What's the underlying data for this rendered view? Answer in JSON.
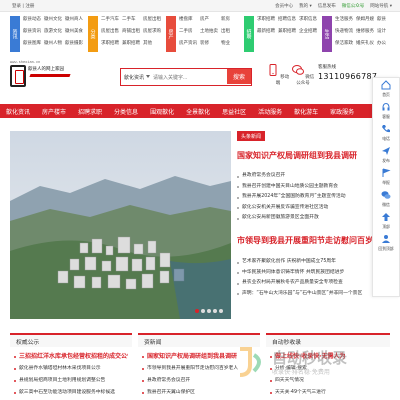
{
  "topbar": {
    "left": "登录 | 注册",
    "right": [
      "会员中心",
      "我的 ▾",
      "信息发布",
      "微信公众号",
      "网站导航 ▾"
    ]
  },
  "nav_groups": [
    {
      "tag": "资讯",
      "color": "#3a7bd5",
      "links": [
        "歙县动态",
        "徽州文化",
        "徽州商人",
        "歙县资讯",
        "旅游文化",
        "徽州美食",
        "歙县图库",
        "徽州人物",
        "歙县摄影"
      ]
    },
    {
      "tag": "分类",
      "color": "#f39c12",
      "links": [
        "二手汽车",
        "二手车",
        "房屋出租",
        "房屋出售",
        "商铺出租",
        "房屋求购",
        "求职招聘",
        "兼职招聘",
        "其他"
      ]
    },
    {
      "tag": "房产",
      "color": "#e74c3c",
      "links": [
        "楼盘库",
        "房产",
        "新房",
        "二手房",
        "土地拍卖",
        "出租",
        "房产资讯",
        "装修",
        "物业"
      ]
    },
    {
      "tag": "招聘",
      "color": "#2ecc71",
      "links": [
        "求职招聘",
        "招聘信息",
        "求职信息",
        "最新招聘",
        "兼职招聘",
        "企业招聘"
      ]
    },
    {
      "tag": "生活",
      "color": "#8e44ad",
      "links": [
        "生活服务",
        "保姆月嫂",
        "歙县",
        "快递物流",
        "维修服务",
        "设计",
        "保洁家政",
        "婚庆礼仪",
        "办公"
      ]
    }
  ],
  "logo": {
    "url": "www.shexian.cn",
    "slogan": "歙县人的网上家园"
  },
  "search": {
    "category": "歙化资讯",
    "placeholder": "请输入关键字...",
    "button": "搜索"
  },
  "icons": [
    {
      "label": "移动端"
    },
    {
      "label": "微信公众号"
    }
  ],
  "phone": {
    "label": "客服热线",
    "number": "13110966787"
  },
  "mainnav": [
    "歙化资讯",
    "房产楼市",
    "招聘求职",
    "分类信息",
    "围观歙化",
    "全景歙化",
    "思益社区",
    "活动服务",
    "歙化游车",
    "家政服务"
  ],
  "headline_badge": "头条新闻",
  "headline1": "国家知识产权局调研组到我县调研",
  "list1": [
    "县政府常务会议召开",
    "我县召开创建中国天目山地质公园主题教育会",
    "我县开展2024年“全国国防教育月”主题宣传活动",
    "歙化公安机关开展反诈骗宣传进社区活动",
    "歙化公安局新团徽旅游景区全面开放"
  ],
  "headline2": "市领导到我县开展重阳节走访慰问百岁老人",
  "list2": [
    "艺术家齐聚歙化创作 庆祝新中国成立75周年",
    "中华民族共同体意识铸牢情怀 共筑民族团结进步",
    "县农业农村局开展秋冬农产品质量安全专项检查",
    "声明：“石牛山大湾乐园”与“石牛山景区”并非同一个景区"
  ],
  "sidebar": [
    {
      "label": "首页",
      "icon": "home-icon"
    },
    {
      "label": "客服",
      "icon": "headset-icon"
    },
    {
      "label": "电话",
      "icon": "phone-icon"
    },
    {
      "label": "发布",
      "icon": "send-icon"
    },
    {
      "label": "举报",
      "icon": "flag-icon"
    },
    {
      "label": "微信",
      "icon": "wechat-icon"
    },
    {
      "label": "顶部",
      "icon": "top-icon"
    },
    {
      "label": "回到顶部",
      "icon": "user-icon"
    }
  ],
  "panels": [
    {
      "title": "权威公示",
      "items": [
        {
          "text": "三招招红洋水库承包经营权招租的成交公告",
          "hl": true
        },
        {
          "text": "歙化县乔水镇塔坦村林木采伐项目公示",
          "hl": false
        },
        {
          "text": "县规划局招商项目土地利用规划调整公告",
          "hl": false
        },
        {
          "text": "歙三高中石至功能活动项目建设服务中标候选",
          "hl": false
        }
      ]
    },
    {
      "title": "资新闻",
      "items": [
        {
          "text": "国家知识产权局调研组到我县调研",
          "hl": true
        },
        {
          "text": "市领导到我县开展重阳节走访慰问百岁老人",
          "hl": false
        },
        {
          "text": "县政府常务会议召开",
          "hl": false
        },
        {
          "text": "我县召开天翼山保护区",
          "hl": false
        }
      ]
    },
    {
      "title": "自动秒收录",
      "items": [
        {
          "text": "做上线快·收录快·无需人为",
          "hl": true
        },
        {
          "text": "分析·编辑·搜索",
          "hl": false
        },
        {
          "text": "四天天气情况",
          "hl": false
        },
        {
          "text": "天天关·49个天气三进行",
          "hl": false
        }
      ]
    }
  ],
  "watermark": {
    "text": "自动秒收录",
    "sub": "收录快·排名稳·免费用"
  }
}
